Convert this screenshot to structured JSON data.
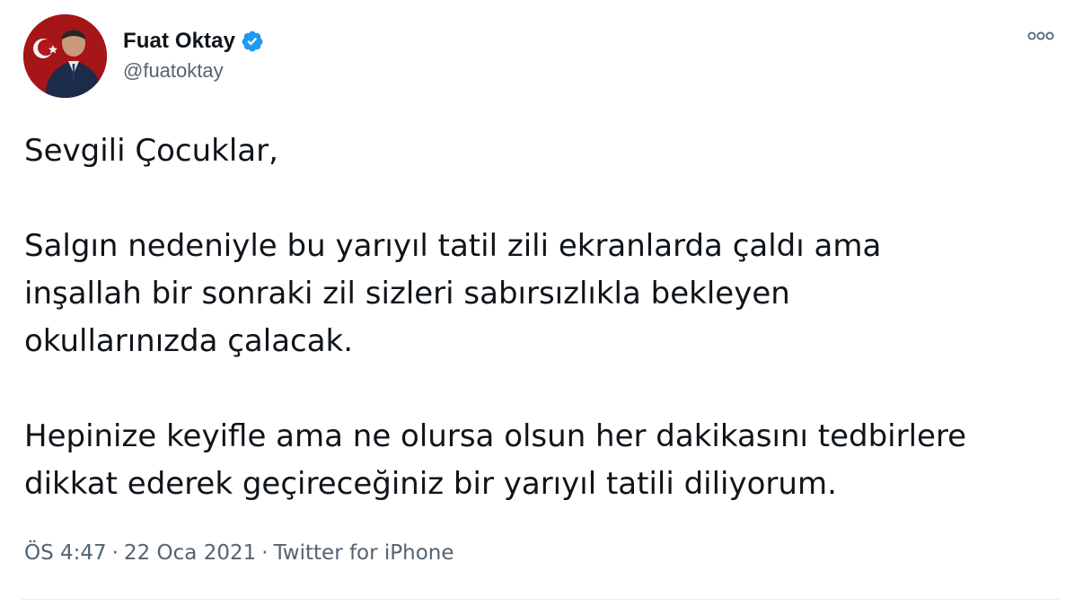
{
  "author": {
    "display_name": "Fuat Oktay",
    "handle": "@fuatoktay",
    "verified": true,
    "avatar_icon": "profile-photo-with-turkish-flag"
  },
  "tweet": {
    "greeting": "Sevgili Çocuklar,",
    "lines": [
      "Salgın nedeniyle bu yarıyıl tatil zili ekranlarda çaldı ama",
      "inşallah bir sonraki zil sizleri sabırsızlıkla bekleyen",
      "okullarınızda çalacak.",
      "Hepinize keyifle ama ne olursa olsun her dakikasını tedbirlere",
      "dikkat ederek geçireceğiniz bir yarıyıl tatili diliyorum."
    ]
  },
  "meta": {
    "time": "ÖS 4:47",
    "separator": "·",
    "date": "22 Oca 2021",
    "source": "Twitter for iPhone"
  },
  "colors": {
    "verified_blue": "#1d9bf0",
    "muted_text": "#536471",
    "primary_text": "#0f1419"
  },
  "icons": {
    "more": "more-options-icon",
    "verified": "verified-badge-icon"
  }
}
